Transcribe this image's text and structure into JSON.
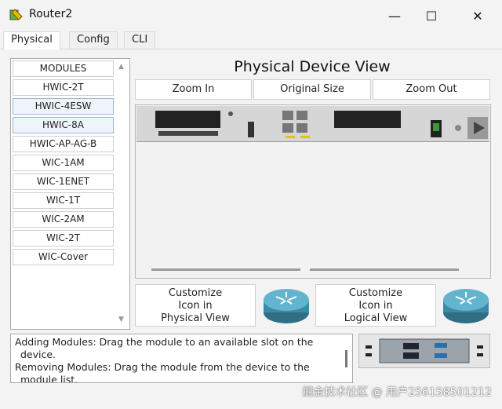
{
  "window": {
    "title": "Router2",
    "minimize": "—",
    "maximize": "☐",
    "close": "✕"
  },
  "tabs": [
    "Physical",
    "Config",
    "CLI"
  ],
  "modules": [
    "MODULES",
    "HWIC-2T",
    "HWIC-4ESW",
    "HWIC-8A",
    "HWIC-AP-AG-B",
    "WIC-1AM",
    "WIC-1ENET",
    "WIC-1T",
    "WIC-2AM",
    "WIC-2T",
    "WIC-Cover"
  ],
  "view": {
    "heading": "Physical Device View",
    "zoom_in": "Zoom In",
    "original_size": "Original Size",
    "zoom_out": "Zoom Out"
  },
  "customize": {
    "physical": [
      "Customize",
      "Icon in",
      "Physical View"
    ],
    "logical": [
      "Customize",
      "Icon in",
      "Logical View"
    ]
  },
  "info": {
    "line1": "Adding Modules: Drag the module to an available slot on the",
    "line2": "device.",
    "line3": "Removing Modules: Drag the module from the device to the",
    "line4": "module list."
  },
  "watermark": "掘金技术社区 @ 用户2561585012​12"
}
